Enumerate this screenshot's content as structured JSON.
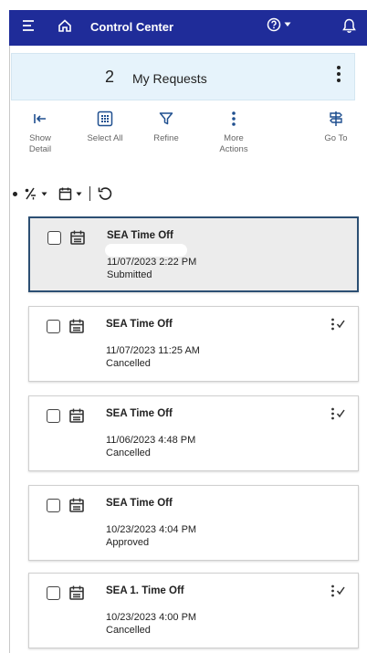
{
  "header": {
    "title": "Control Center"
  },
  "requests": {
    "count": "2",
    "label": "My Requests"
  },
  "actions": [
    {
      "line1": "Show",
      "line2": "Detail"
    },
    {
      "line1": "Select All",
      "line2": ""
    },
    {
      "line1": "Refine",
      "line2": ""
    },
    {
      "line1": "More",
      "line2": "Actions"
    },
    {
      "line1": "Go To",
      "line2": ""
    }
  ],
  "cards": [
    {
      "title": "SEA Time Off",
      "date": "11/07/2023 2:22 PM",
      "status": "Submitted",
      "selected": true,
      "flow_icon": false
    },
    {
      "title": "SEA Time Off",
      "date": "11/07/2023 11:25 AM",
      "status": "Cancelled",
      "selected": false,
      "flow_icon": true
    },
    {
      "title": "SEA Time Off",
      "date": "11/06/2023 4:48 PM",
      "status": "Cancelled",
      "selected": false,
      "flow_icon": true
    },
    {
      "title": "SEA Time Off",
      "date": "10/23/2023 4:04 PM",
      "status": "Approved",
      "selected": false,
      "flow_icon": false
    },
    {
      "title": "SEA 1. Time Off",
      "date": "10/23/2023 4:00 PM",
      "status": "Cancelled",
      "selected": false,
      "flow_icon": true
    }
  ],
  "icons": {
    "menu": "hamburger-menu-icon",
    "home": "home-icon",
    "help": "help-icon",
    "bell": "bell-icon",
    "kebab": "kebab-icon",
    "calendar": "calendar-icon",
    "flow": "flow-icon"
  },
  "colors": {
    "header_bg": "#1f2c99",
    "requests_bg": "#e6f3fb",
    "accent": "#1f4f8f",
    "selected_border": "#2c4f73"
  }
}
